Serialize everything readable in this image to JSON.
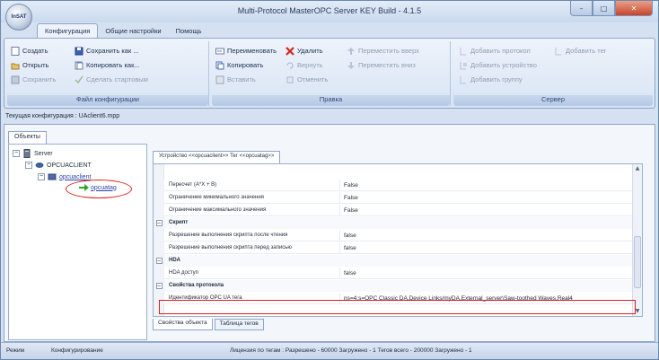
{
  "window": {
    "title": "Multi-Protocol MasterOPC Server KEY Build - 4.1.5",
    "logo_text": "InSAT",
    "controls": {
      "minimize": "–",
      "maximize": "□",
      "close": "✕"
    }
  },
  "ribbon_tabs": [
    "Конфигурация",
    "Общие настройки",
    "Помощь"
  ],
  "ribbon": {
    "file_group": {
      "title": "Файл конфигурации",
      "create": "Создать",
      "open": "Открыть",
      "save": "Сохранить",
      "save_as": "Сохранить как ...",
      "copy_as": "Копировать как...",
      "make_startup": "Сделать стартовым"
    },
    "edit_group": {
      "title": "Правка",
      "rename": "Переименовать",
      "copy": "Копировать",
      "paste": "Вставить",
      "delete": "Удалить",
      "revert": "Вернуть",
      "cancel": "Отменить",
      "move_up": "Переместить вверх",
      "move_down": "Переместить вниз"
    },
    "server_group": {
      "title": "Сервер",
      "add_protocol": "Добавить протокол",
      "add_tag": "Добавить тег",
      "add_device": "Добавить устройство",
      "add_group": "Добавить группу"
    }
  },
  "config_path": "Текущая конфигурация : UAclient6.mpp",
  "objects_tab": "Объекты",
  "tree": {
    "server": "Server",
    "client": "OPCUACLIENT",
    "device": "opcuaclient",
    "tag": "opcuatag"
  },
  "editor_tab": "Устройство <<opcuaclient>> Тег <<opcuatag>>",
  "properties": [
    {
      "type": "row",
      "name": "Пересчет (A*X + B)",
      "value": "False"
    },
    {
      "type": "row",
      "name": "Ограничение минимального значения",
      "value": "False"
    },
    {
      "type": "row",
      "name": "Ограничение максимального значения",
      "value": "False"
    },
    {
      "type": "cat",
      "name": "Скрипт",
      "value": ""
    },
    {
      "type": "row",
      "name": "Разрешение выполнения скрипта после чтения",
      "value": "false"
    },
    {
      "type": "row",
      "name": "Разрешение выполнения скрипта перед записью",
      "value": "false"
    },
    {
      "type": "cat",
      "name": "HDA",
      "value": ""
    },
    {
      "type": "row",
      "name": "HDA доступ",
      "value": "false"
    },
    {
      "type": "cat",
      "name": "Свойства протокола",
      "value": ""
    },
    {
      "type": "row",
      "name": "Идентификатор OPC UA тега",
      "value": "ns=4;s=OPC Classic DA.Device Links/myDA.External_server\\Saw-toothed Waves.Real4"
    }
  ],
  "bottom_tabs": [
    "Свойства объекта",
    "Таблица тегов"
  ],
  "status": {
    "mode_label": "Режим",
    "mode_value": "Конфигурирование",
    "license": "Лицензия по тегам : Разрешено - 60000 Загружено - 1 Тегов всего - 200000 Загружено - 1"
  }
}
